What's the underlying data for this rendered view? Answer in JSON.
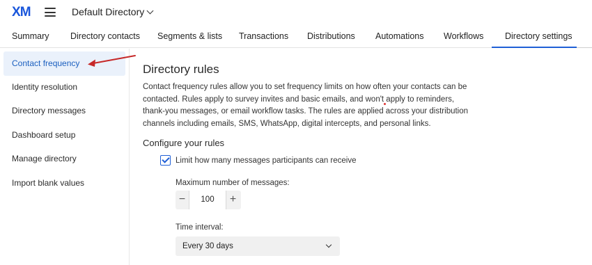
{
  "header": {
    "logo_x": "X",
    "logo_m": "M",
    "directory": "Default Directory"
  },
  "tabs": [
    {
      "label": "Summary"
    },
    {
      "label": "Directory contacts"
    },
    {
      "label": "Segments & lists"
    },
    {
      "label": "Transactions"
    },
    {
      "label": "Distributions"
    },
    {
      "label": "Automations"
    },
    {
      "label": "Workflows"
    },
    {
      "label": "Directory settings",
      "active": true
    }
  ],
  "sidebar": {
    "items": [
      {
        "label": "Contact frequency",
        "active": true
      },
      {
        "label": "Identity resolution"
      },
      {
        "label": "Directory messages"
      },
      {
        "label": "Dashboard setup"
      },
      {
        "label": "Manage directory"
      },
      {
        "label": "Import blank values"
      }
    ]
  },
  "main": {
    "title": "Directory rules",
    "description": "Contact frequency rules allow you to set frequency limits on how often your contacts can be contacted. Rules apply to survey invites and basic emails, and won't apply to reminders, thank-you messages, or email workflow tasks. The rules are applied across your distribution channels including emails, SMS, WhatsApp, digital intercepts, and personal links.",
    "configure_title": "Configure your rules",
    "limit_checkbox_label": "Limit how many messages participants can receive",
    "limit_checked": true,
    "max_label": "Maximum number of messages:",
    "max_value": "100",
    "minus": "−",
    "plus": "+",
    "time_label": "Time interval:",
    "time_value": "Every 30 days"
  },
  "colors": {
    "accent": "#1f5fd6",
    "active_bg": "#eaf1fb",
    "annotation_arrow": "#c62828"
  },
  "icons": {
    "menu": "hamburger-icon",
    "dropdown": "chevron-down-icon",
    "check": "checkmark-icon",
    "annotation": "red-arrow-icon"
  }
}
